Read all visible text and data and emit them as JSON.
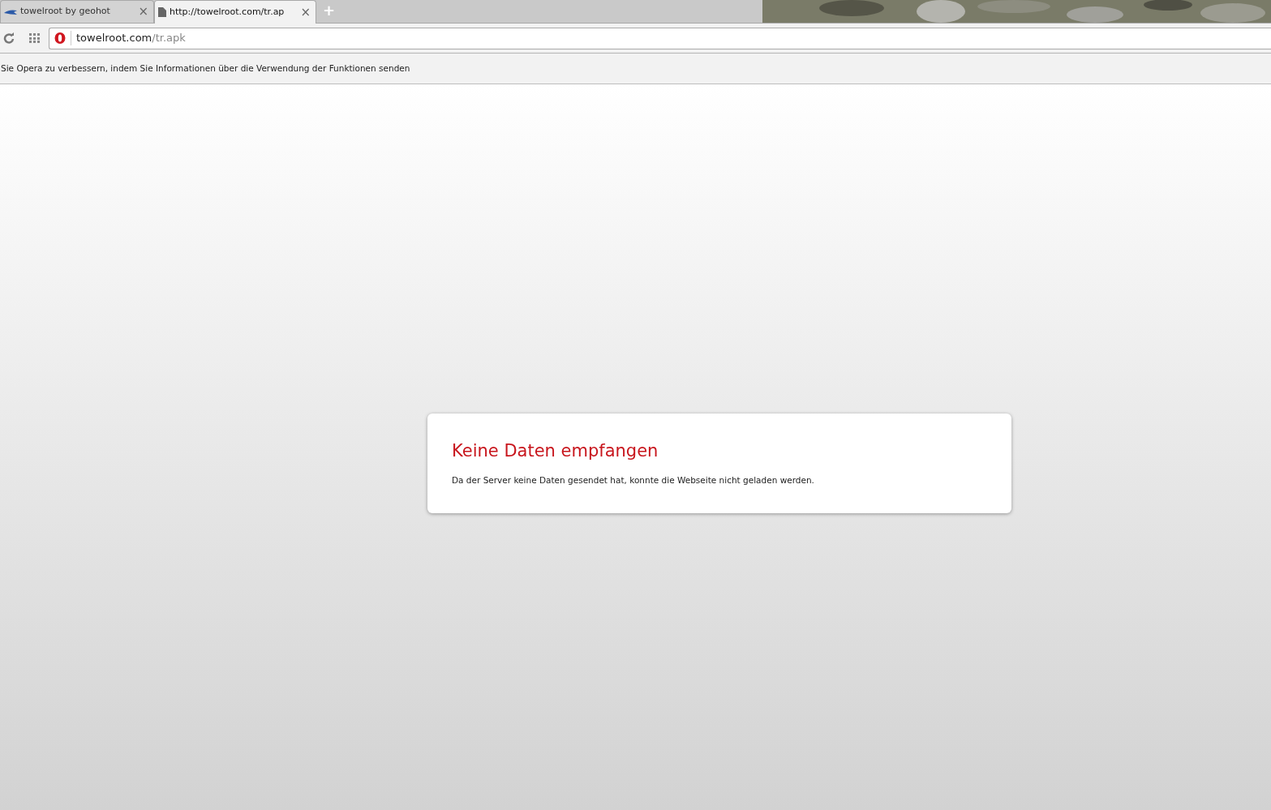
{
  "tabs": [
    {
      "title": "towelroot by geohot",
      "selected": false,
      "close": "×"
    },
    {
      "title": "http://towelroot.com/tr.ap",
      "selected": true,
      "close": "×"
    }
  ],
  "new_tab": "+",
  "address": {
    "host": "towelroot.com",
    "path": "/tr.apk"
  },
  "info_bar": {
    "text": "Sie Opera zu verbessern, indem Sie Informationen über die Verwendung der Funktionen senden"
  },
  "error": {
    "title": "Keine Daten empfangen",
    "message": "Da der Server keine Daten gesendet hat, konnte die Webseite nicht geladen werden."
  }
}
